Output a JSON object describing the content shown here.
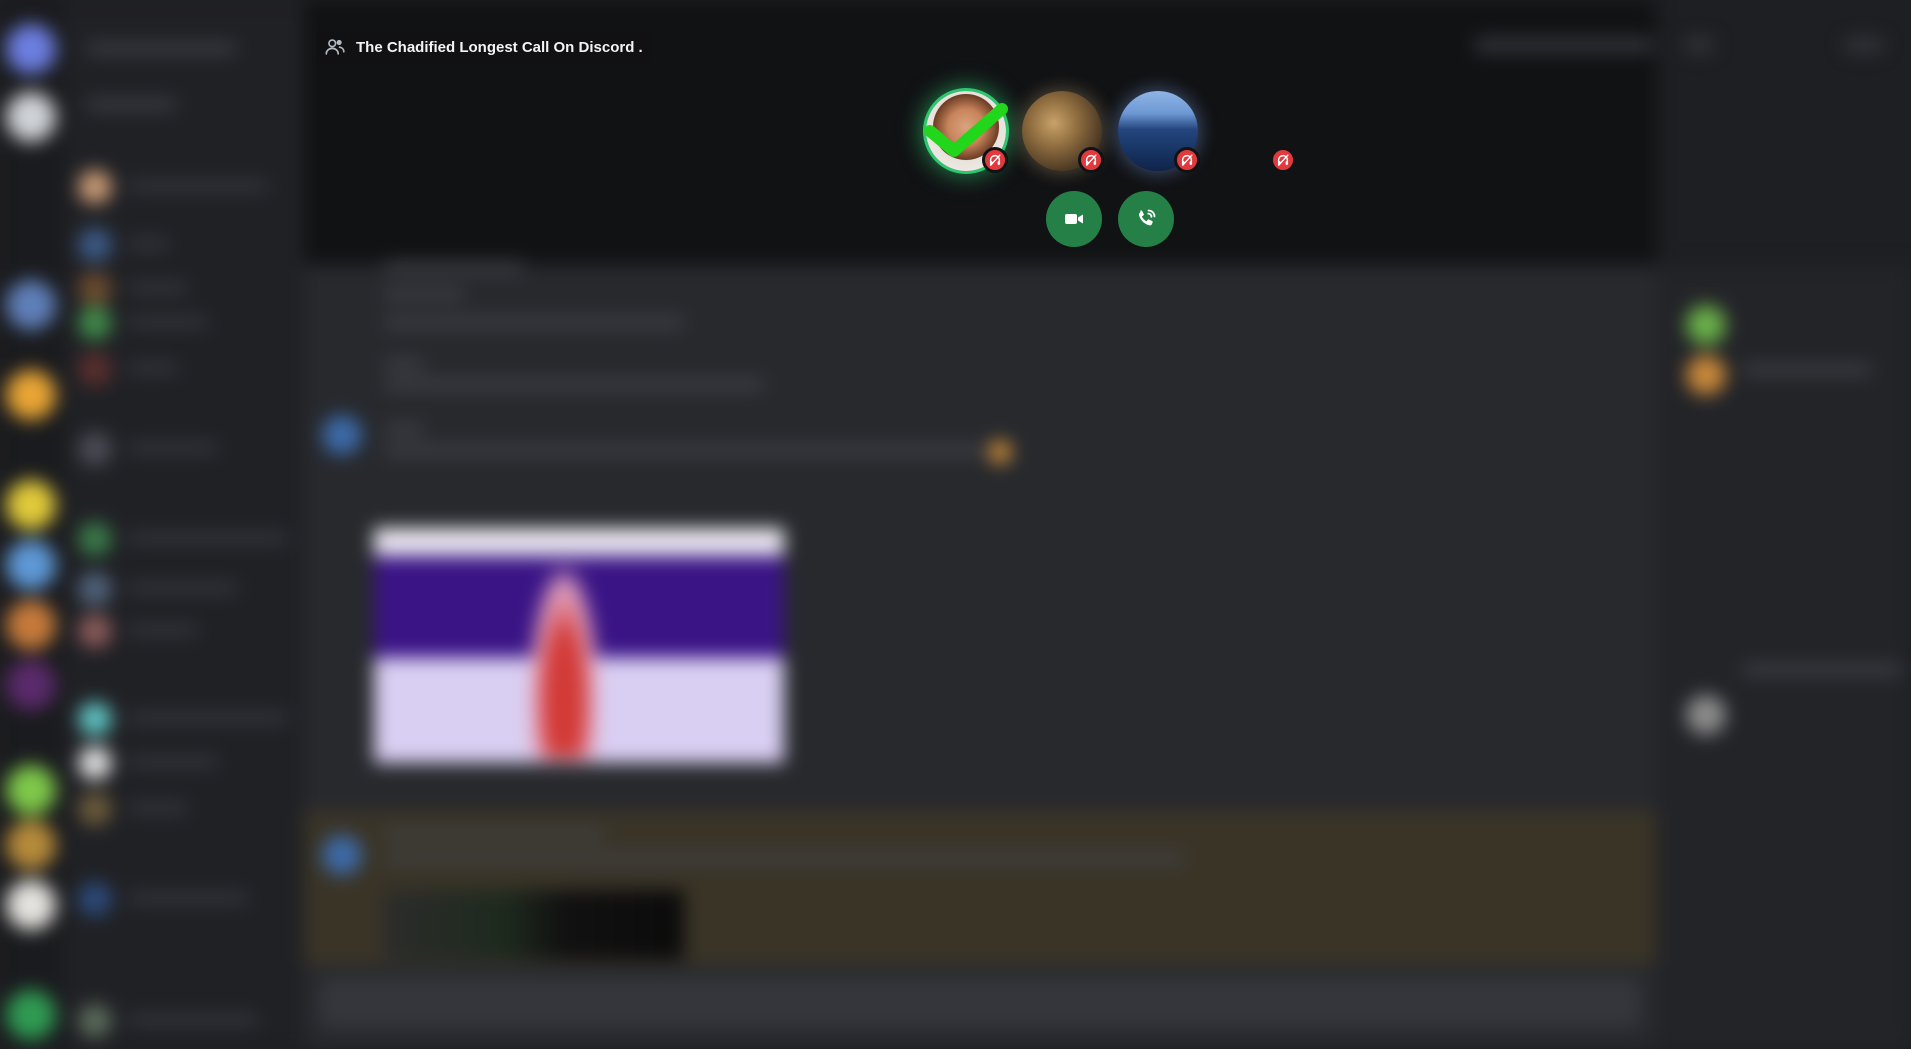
{
  "call": {
    "title": "The Chadified Longest Call On Discord .",
    "participants": [
      {
        "id": "p1",
        "speaking": true,
        "muted": true
      },
      {
        "id": "p2",
        "speaking": false,
        "muted": true
      },
      {
        "id": "p3",
        "speaking": false,
        "muted": true
      },
      {
        "id": "p4",
        "speaking": false,
        "muted": true
      }
    ],
    "buttons": {
      "video": "camera-icon",
      "voice": "phone-ringing-icon"
    }
  },
  "colors": {
    "call_bg": "#111214",
    "chat_bg": "#27292d",
    "accent_green": "#248046",
    "speaking_ring": "#2dc770",
    "muted_red": "#e03a3e",
    "highlight_msg": "#3a3427"
  }
}
